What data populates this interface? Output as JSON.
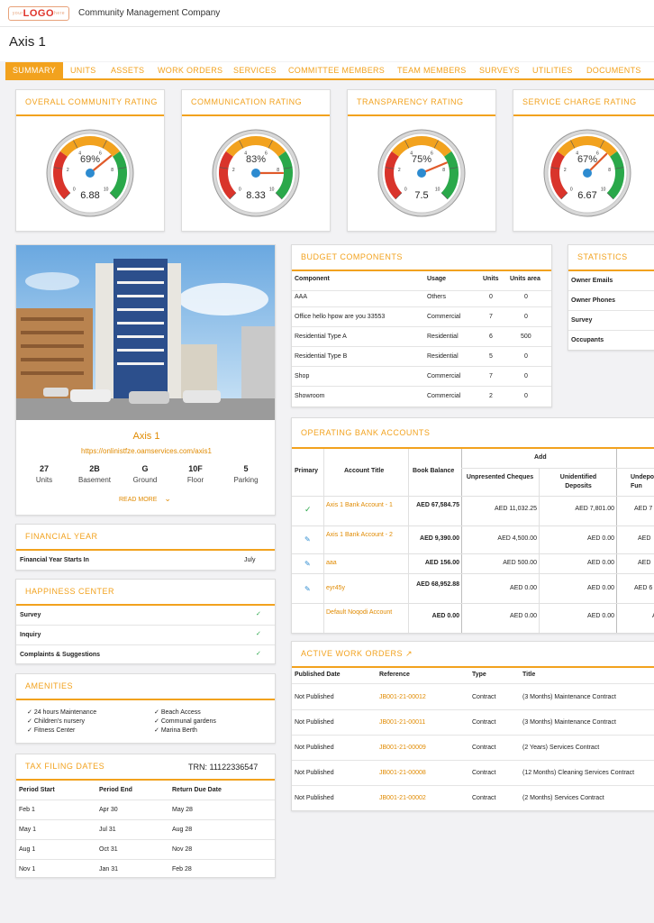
{
  "header": {
    "logo_text": "LOGO",
    "logo_small_left": "your",
    "logo_small_right": "here",
    "company": "Community Management Company"
  },
  "page_title": "Axis 1",
  "tabs": [
    "SUMMARY",
    "UNITS",
    "ASSETS",
    "WORK ORDERS",
    "SERVICES",
    "COMMITTEE MEMBERS",
    "TEAM MEMBERS",
    "SURVEYS",
    "UTILITIES",
    "DOCUMENTS"
  ],
  "ratings": [
    {
      "title": "OVERALL COMMUNITY RATING",
      "percent": "69%",
      "value": "6.88",
      "level": 0.688
    },
    {
      "title": "COMMUNICATION RATING",
      "percent": "83%",
      "value": "8.33",
      "level": 0.833
    },
    {
      "title": "TRANSPARENCY RATING",
      "percent": "75%",
      "value": "7.5",
      "level": 0.75
    },
    {
      "title": "SERVICE CHARGE RATING",
      "percent": "67%",
      "value": "6.67",
      "level": 0.667
    }
  ],
  "gauge_ticks": [
    "0",
    "2",
    "4",
    "6",
    "8",
    "10"
  ],
  "property": {
    "name": "Axis 1",
    "url": "https://onlinistfze.oamservices.com/axis1",
    "stats": [
      {
        "value": "27",
        "label": "Units"
      },
      {
        "value": "2B",
        "label": "Basement"
      },
      {
        "value": "G",
        "label": "Ground"
      },
      {
        "value": "10F",
        "label": "Floor"
      },
      {
        "value": "5",
        "label": "Parking"
      }
    ],
    "read_more": "READ MORE"
  },
  "financial_year": {
    "title": "FINANCIAL YEAR",
    "label": "Financial Year Starts In",
    "value": "July"
  },
  "happiness": {
    "title": "HAPPINESS CENTER",
    "items": [
      "Survey",
      "Inquiry",
      "Complaints & Suggestions"
    ]
  },
  "amenities": {
    "title": "AMENITIES",
    "left": [
      "24 hours Maintenance",
      "Children's nursery",
      "Fitness Center"
    ],
    "right": [
      "Beach Access",
      "Communal gardens",
      "Marina Berth"
    ]
  },
  "tax": {
    "title": "TAX FILING DATES",
    "trn": "TRN: 11122336547",
    "headers": [
      "Period Start",
      "Period End",
      "Return Due Date"
    ],
    "rows": [
      [
        "Feb 1",
        "Apr 30",
        "May 28"
      ],
      [
        "May 1",
        "Jul 31",
        "Aug 28"
      ],
      [
        "Aug 1",
        "Oct 31",
        "Nov 28"
      ],
      [
        "Nov 1",
        "Jan 31",
        "Feb 28"
      ]
    ]
  },
  "budget": {
    "title": "BUDGET COMPONENTS",
    "headers": [
      "Component",
      "Usage",
      "Units",
      "Units area"
    ],
    "rows": [
      [
        "AAA",
        "Others",
        "0",
        "0"
      ],
      [
        "Office hello hpow are you 33553",
        "Commercial",
        "7",
        "0"
      ],
      [
        "Residential Type A",
        "Residential",
        "6",
        "500"
      ],
      [
        "Residential Type B",
        "Residential",
        "5",
        "0"
      ],
      [
        "Shop",
        "Commercial",
        "7",
        "0"
      ],
      [
        "Showroom",
        "Commercial",
        "2",
        "0"
      ]
    ]
  },
  "statistics": {
    "title": "STATISTICS",
    "items": [
      "Owner Emails",
      "Owner Phones",
      "Survey",
      "Occupants"
    ]
  },
  "bank": {
    "title": "OPERATING BANK ACCOUNTS",
    "headers": {
      "primary": "Primary",
      "account": "Account Title",
      "balance": "Book Balance",
      "add": "Add",
      "unpresented": "Unpresented Cheques",
      "unidentified": "Unidentified Deposits",
      "undep": "Undepo Fun"
    },
    "rows": [
      {
        "icon": "check",
        "account": "Axis 1 Bank Account - 1",
        "balance": "AED 67,584.75",
        "unpresented": "AED 11,032.25",
        "unidentified": "AED 7,801.00",
        "undep": "AED 7"
      },
      {
        "icon": "edit",
        "account": "Axis 1 Bank Account - 2",
        "balance": "AED 9,390.00",
        "unpresented": "AED 4,500.00",
        "unidentified": "AED 0.00",
        "undep": "AED"
      },
      {
        "icon": "edit",
        "account": "aaa",
        "balance": "AED 156.00",
        "unpresented": "AED 500.00",
        "unidentified": "AED 0.00",
        "undep": "AED"
      },
      {
        "icon": "edit",
        "account": "eyr45y",
        "balance": "AED 68,952.88",
        "unpresented": "AED 0.00",
        "unidentified": "AED 0.00",
        "undep": "AED 6"
      },
      {
        "icon": "",
        "account": "Default Noqodi Account",
        "balance": "AED 0.00",
        "unpresented": "AED 0.00",
        "unidentified": "AED 0.00",
        "undep": "A"
      }
    ]
  },
  "work_orders": {
    "title": "ACTIVE WORK ORDERS",
    "headers": [
      "Published Date",
      "Reference",
      "Type",
      "Title"
    ],
    "rows": [
      [
        "Not Published",
        "JB001-21-00012",
        "Contract",
        "(3 Months) Maintenance Contract"
      ],
      [
        "Not Published",
        "JB001-21-00011",
        "Contract",
        "(3 Months) Maintenance Contract"
      ],
      [
        "Not Published",
        "JB001-21-00009",
        "Contract",
        "(2 Years) Services Contract"
      ],
      [
        "Not Published",
        "JB001-21-00008",
        "Contract",
        "(12 Months) Cleaning Services Contract"
      ],
      [
        "Not Published",
        "JB001-21-00002",
        "Contract",
        "(2 Months) Services Contract"
      ]
    ]
  },
  "colors": {
    "accent": "#f2a21e",
    "red": "#d9342b",
    "green": "#2aa84a",
    "needle": "#e05a2a",
    "blue": "#2d8bd0"
  }
}
